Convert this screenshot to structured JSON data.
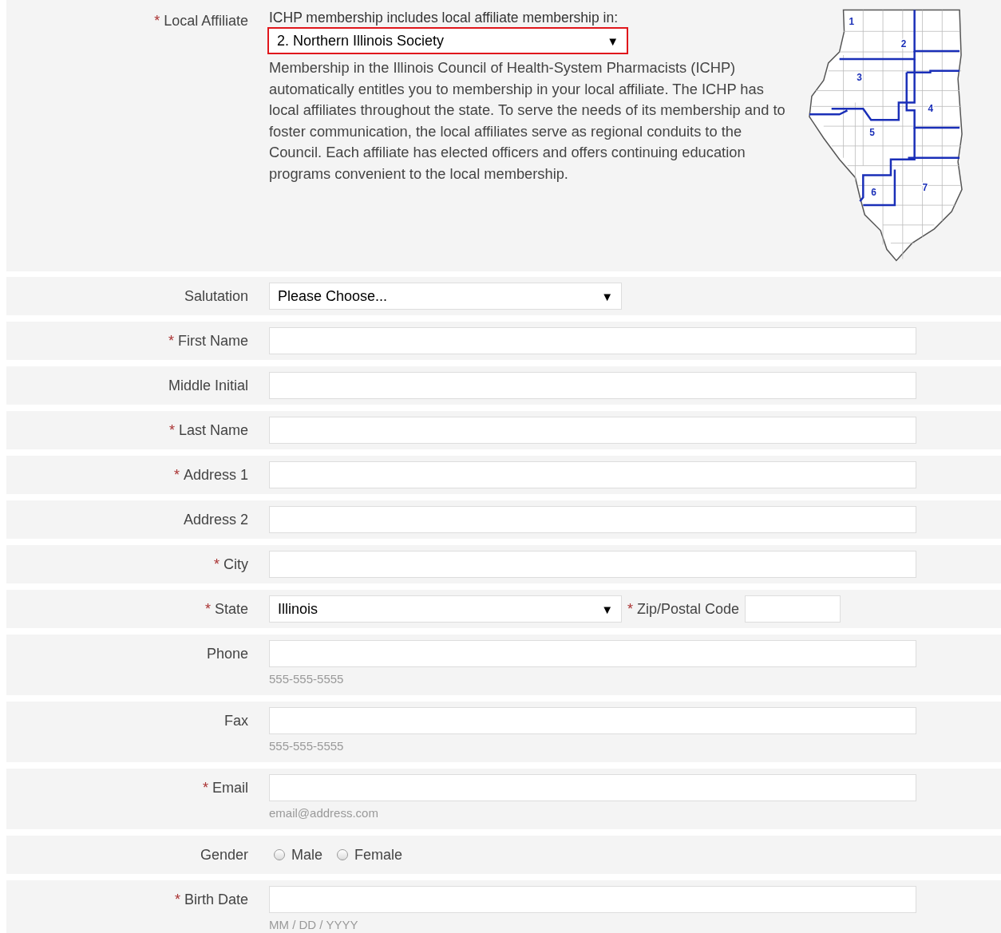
{
  "affiliate": {
    "required_mark": "*",
    "label": "Local Affiliate",
    "intro": "ICHP membership includes local affiliate membership in:",
    "select": {
      "value": "2. Northern Illinois Society",
      "arrow": "▼",
      "highlighted": true
    },
    "description": "Membership in the Illinois Council of Health-System Pharmacists (ICHP) automatically entitles you to membership in your local affiliate. The ICHP has local affiliates throughout the state. To serve the needs of its membership and to foster communication, the local affiliates serve as regional conduits to the Council. Each affiliate has elected officers and offers continuing education programs convenient to the local membership.",
    "map_regions": [
      "1",
      "2",
      "3",
      "4",
      "5",
      "6",
      "7"
    ]
  },
  "rows": [
    {
      "kind": "select",
      "label": "Salutation",
      "value": "Please Choose...",
      "arrow": "▼"
    },
    {
      "kind": "text",
      "required_mark": "*",
      "label": "First Name"
    },
    {
      "kind": "text",
      "label": "Middle Initial"
    },
    {
      "kind": "text",
      "required_mark": "*",
      "label": "Last Name"
    },
    {
      "kind": "text",
      "required_mark": "*",
      "label": "Address 1"
    },
    {
      "kind": "text",
      "label": "Address 2"
    },
    {
      "kind": "text",
      "required_mark": "*",
      "label": "City"
    },
    {
      "kind": "state_zip",
      "required_mark": "*",
      "label": "State",
      "value": "Illinois",
      "arrow": "▼",
      "zip": {
        "required_mark": "*",
        "label": "Zip/Postal Code"
      }
    },
    {
      "kind": "text",
      "label": "Phone",
      "hint": "555-555-5555"
    },
    {
      "kind": "text",
      "label": "Fax",
      "hint": "555-555-5555"
    },
    {
      "kind": "text",
      "required_mark": "*",
      "label": "Email",
      "hint": "email@address.com"
    },
    {
      "kind": "radio",
      "label": "Gender",
      "options": [
        {
          "label": "Male",
          "selected": false
        },
        {
          "label": "Female",
          "selected": false
        }
      ]
    },
    {
      "kind": "text",
      "required_mark": "*",
      "label": "Birth Date",
      "hint": "MM / DD / YYYY"
    }
  ]
}
